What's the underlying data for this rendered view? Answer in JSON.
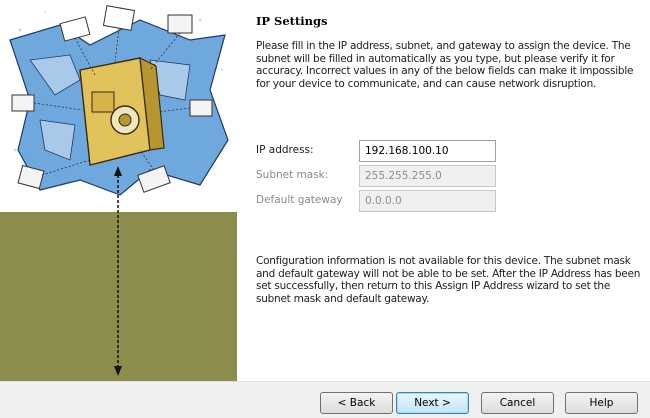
{
  "sidebar": {
    "illustration": "network-map-illustration"
  },
  "page": {
    "title": "IP Settings",
    "intro": "Please fill in the IP address, subnet, and gateway to assign the device. The subnet will be filled in automatically as you type, but please verify it for accuracy.  Incorrect values in any of the below fields can make it impossible for your device to communicate, and can cause network disruption.",
    "note": "Configuration information is not available for this device.  The subnet mask and default gateway will not be able to be set.  After the IP Address has been set successfully, then return to this Assign IP Address wizard to set the subnet mask and default gateway."
  },
  "form": {
    "ip_label": "IP address:",
    "ip_value": "192.168.100.10",
    "subnet_label": "Subnet mask:",
    "subnet_value": "255.255.255.0",
    "gateway_label": "Default gateway",
    "gateway_value": "0.0.0.0"
  },
  "buttons": {
    "back": "< Back",
    "next": "Next >",
    "cancel": "Cancel",
    "help": "Help"
  },
  "colors": {
    "sidebar_bg": "#8c8c4c",
    "footer_bg": "#f0f0f0"
  }
}
